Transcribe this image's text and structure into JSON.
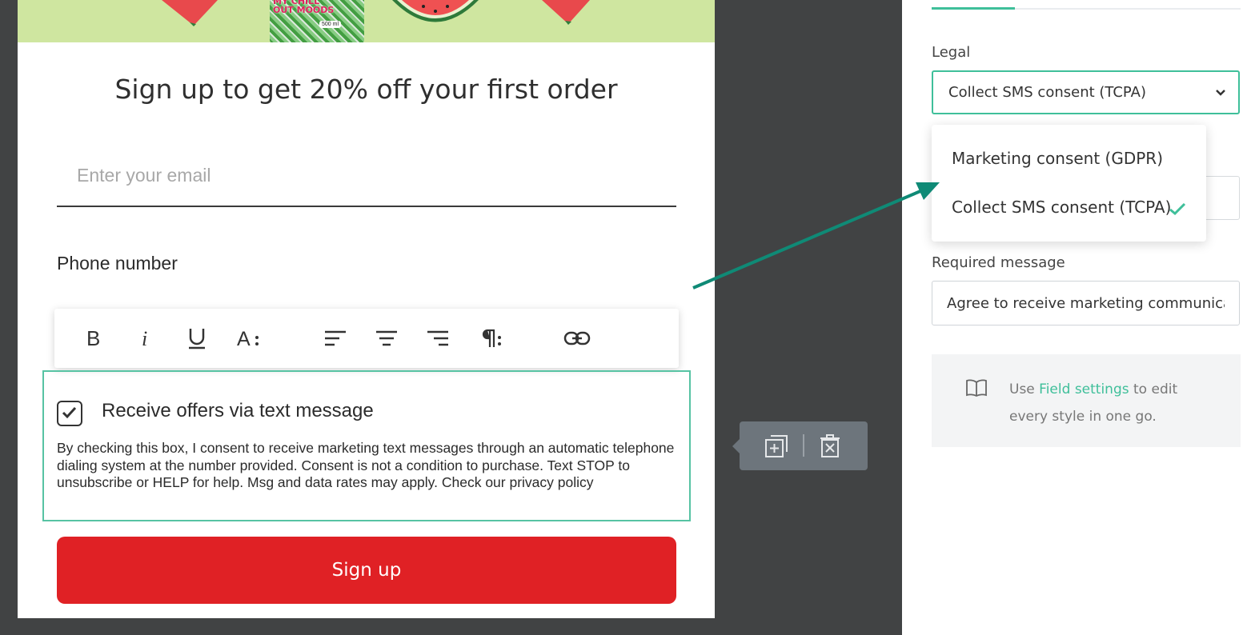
{
  "form": {
    "hero_can_text": "MY CHILL OUT MOODS",
    "hero_can_badge": "500 ml",
    "headline": "Sign up to get 20% off your first order",
    "email_placeholder": "Enter your email",
    "phone_label": "Phone number",
    "toolbar": {
      "bold_icon": "bold-icon",
      "italic_icon": "italic-icon",
      "underline_icon": "underline-icon",
      "font_size_icon": "font-size-icon",
      "align_left_icon": "align-left-icon",
      "align_center_icon": "align-center-icon",
      "align_right_icon": "align-right-icon",
      "paragraph_icon": "paragraph-icon",
      "link_icon": "link-icon"
    },
    "consent": {
      "checked": true,
      "label": "Receive offers via text message",
      "text": "By checking this box, I consent to receive marketing text messages through an automatic telephone dialing system at the number provided. Consent is not a condition to purchase. Text STOP to unsubscribe or HELP for help. Msg and data rates may apply. Check our privacy policy"
    },
    "submit_label": "Sign up"
  },
  "float_actions": {
    "duplicate_icon": "duplicate-icon",
    "delete_icon": "delete-icon"
  },
  "panel": {
    "legal_label": "Legal",
    "legal_selected": "Collect SMS consent (TCPA)",
    "legal_options": [
      "Marketing consent (GDPR)",
      "Collect SMS consent (TCPA)"
    ],
    "required_message_label": "Required message",
    "required_message_value": "Agree to receive marketing communications",
    "tip": {
      "prefix": "Use ",
      "link": "Field settings",
      "suffix": " to edit every style in one go."
    }
  },
  "colors": {
    "accent": "#3fbf9a",
    "arrow": "#0f8a76",
    "submit": "#e02125",
    "canvas": "#414344"
  }
}
